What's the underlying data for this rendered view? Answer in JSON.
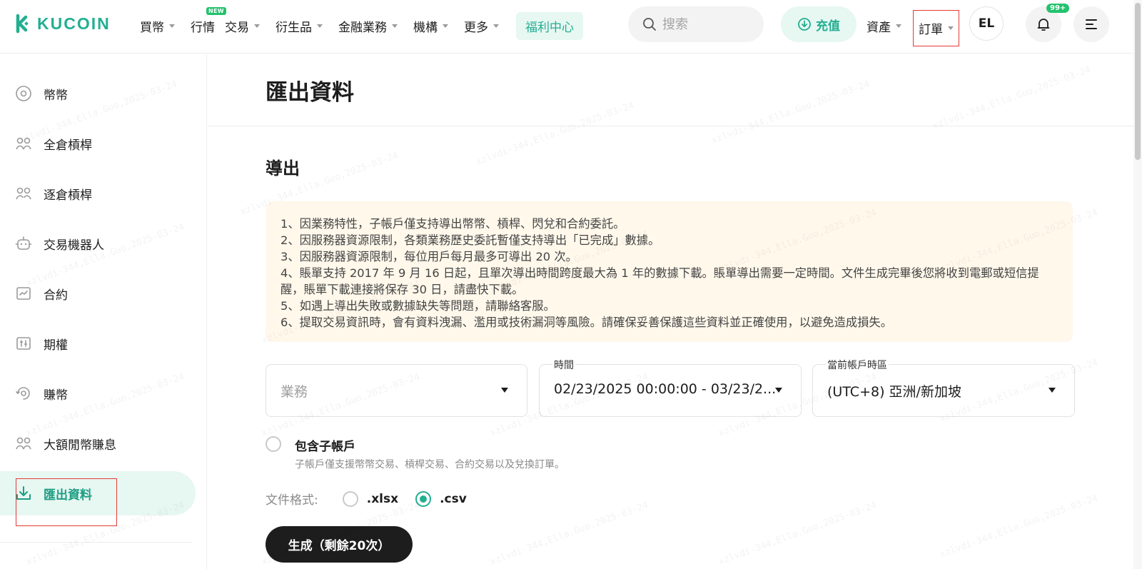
{
  "header": {
    "logo_text": "KUCOIN",
    "nav": [
      {
        "label": "買幣",
        "caret": true
      },
      {
        "label": "行情",
        "caret": false,
        "badge": "NEW"
      },
      {
        "label": "交易",
        "caret": true
      },
      {
        "label": "衍生品",
        "caret": true
      },
      {
        "label": "金融業務",
        "caret": true
      },
      {
        "label": "機構",
        "caret": true
      },
      {
        "label": "更多",
        "caret": true
      }
    ],
    "welfare_label": "福利中心",
    "search_placeholder": "搜索",
    "deposit_label": "充值",
    "assets_label": "資產",
    "orders_label": "訂單",
    "avatar_initials": "EL",
    "notification_badge": "99+"
  },
  "sidebar": {
    "items": [
      {
        "label": "幣幣",
        "icon": "coin-icon"
      },
      {
        "label": "全倉槓桿",
        "icon": "cross-margin-icon"
      },
      {
        "label": "逐倉槓桿",
        "icon": "isolated-margin-icon"
      },
      {
        "label": "交易機器人",
        "icon": "robot-icon"
      },
      {
        "label": "合約",
        "icon": "futures-icon"
      },
      {
        "label": "期權",
        "icon": "options-icon"
      },
      {
        "label": "賺幣",
        "icon": "earn-icon"
      },
      {
        "label": "大額閒幣賺息",
        "icon": "lending-icon"
      },
      {
        "label": "匯出資料",
        "icon": "download-icon",
        "active": true
      }
    ]
  },
  "main": {
    "page_title": "匯出資料",
    "section_title": "導出",
    "notices": [
      "1、因業務特性，子帳戶僅支持導出幣幣、槓桿、閃兌和合約委託。",
      "2、因服務器資源限制，各類業務歷史委託暫僅支持導出「已完成」數據。",
      "3、因服務器資源限制，每位用戶每月最多可導出 20 次。",
      "4、賬單支持 2017 年 9 月 16 日起，且單次導出時間跨度最大為 1 年的數據下載。賬單導出需要一定時間。文件生成完畢後您將收到電郵或短信提醒，賬單下載連接將保存 30 日，請盡快下載。",
      "5、如遇上導出失敗或數據缺失等問題，請聯絡客服。",
      "6、提取交易資訊時，會有資料洩漏、濫用或技術漏洞等風險。請確保妥善保護這些資料並正確使用，以避免造成損失。"
    ],
    "business_field": {
      "placeholder": "業務"
    },
    "time_field": {
      "label": "時間",
      "value": "02/23/2025 00:00:00 - 03/23/2..."
    },
    "timezone_field": {
      "label": "當前帳戶時區",
      "value": "(UTC+8) 亞洲/新加坡"
    },
    "include_subaccount": {
      "label": "包含子帳戶",
      "hint": "子帳戶僅支援幣幣交易、槓桿交易、合約交易以及兌換訂單。",
      "checked": false
    },
    "file_format": {
      "label": "文件格式:",
      "options": [
        ".xlsx",
        ".csv"
      ],
      "selected": ".csv"
    },
    "generate_button": "生成（剩餘20次）"
  },
  "watermark_text": "xzlvdi-344,Ella.Guo,2025-03-24",
  "colors": {
    "brand": "#23af91",
    "highlight": "#e53935",
    "notice_bg": "#fff8eb"
  }
}
